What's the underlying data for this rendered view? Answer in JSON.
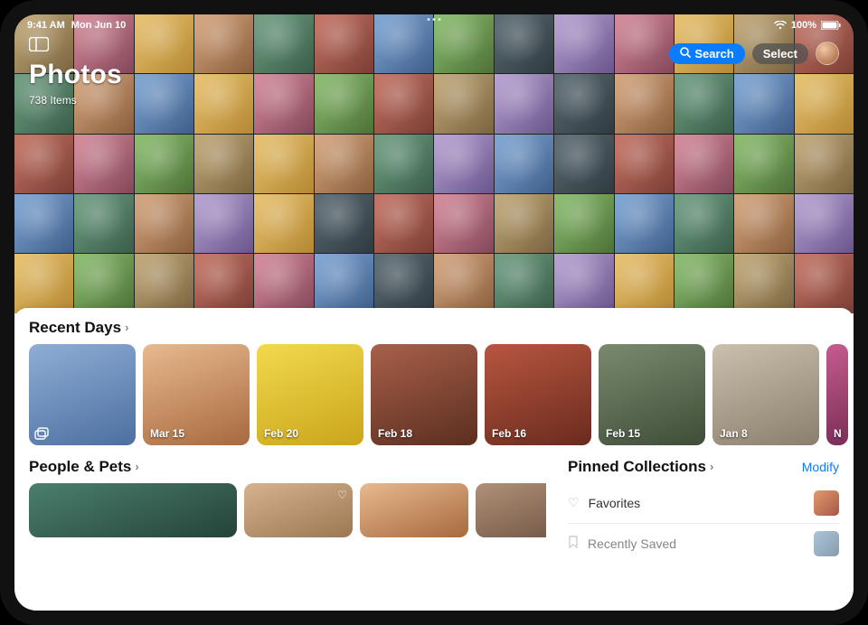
{
  "status": {
    "time": "9:41 AM",
    "date": "Mon Jun 10",
    "battery": "100%"
  },
  "header": {
    "title": "Photos",
    "subtitle": "738 Items",
    "search_label": "Search",
    "select_label": "Select"
  },
  "sections": {
    "recent_days": {
      "title": "Recent Days"
    },
    "people_pets": {
      "title": "People & Pets"
    },
    "pinned": {
      "title": "Pinned Collections",
      "modify_label": "Modify"
    }
  },
  "recent_days": [
    {
      "label": ""
    },
    {
      "label": "Mar 15"
    },
    {
      "label": "Feb 20"
    },
    {
      "label": "Feb 18"
    },
    {
      "label": "Feb 16"
    },
    {
      "label": "Feb 15"
    },
    {
      "label": "Jan 8"
    },
    {
      "label": "N"
    }
  ],
  "people_pets": [
    {
      "label": ""
    },
    {
      "label": ""
    },
    {
      "label": ""
    },
    {
      "label": ""
    }
  ],
  "pinned_items": [
    {
      "label": "Favorites",
      "icon": "heart"
    },
    {
      "label": "Recently Saved",
      "icon": "bookmark"
    }
  ]
}
